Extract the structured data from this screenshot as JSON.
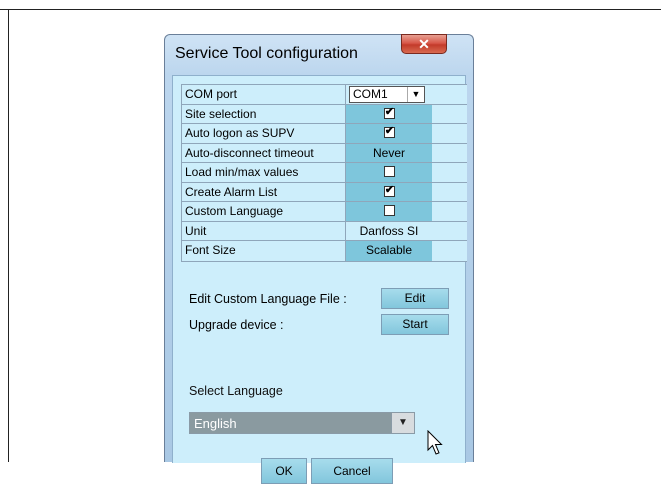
{
  "window": {
    "title": "Service Tool configuration",
    "close_icon": "close-icon"
  },
  "settings": [
    {
      "label": "COM port",
      "type": "combo",
      "value": "COM1"
    },
    {
      "label": "Site selection",
      "type": "checkbox",
      "checked": true
    },
    {
      "label": "Auto logon as SUPV",
      "type": "checkbox",
      "checked": true
    },
    {
      "label": "Auto-disconnect timeout",
      "type": "text",
      "value": "Never"
    },
    {
      "label": "Load min/max values",
      "type": "checkbox",
      "checked": false
    },
    {
      "label": "Create Alarm List",
      "type": "checkbox",
      "checked": true
    },
    {
      "label": "Custom Language",
      "type": "checkbox",
      "checked": false
    },
    {
      "label": "Unit",
      "type": "text-plain",
      "value": "Danfoss SI"
    },
    {
      "label": "Font Size",
      "type": "text",
      "value": "Scalable"
    }
  ],
  "actions": {
    "edit_custom_language_label": "Edit Custom Language File :",
    "edit_button": "Edit",
    "upgrade_device_label": "Upgrade device :",
    "start_button": "Start"
  },
  "language": {
    "label": "Select Language",
    "selected": "English"
  },
  "buttons": {
    "ok": "OK",
    "cancel": "Cancel"
  },
  "colors": {
    "client_bg": "#cdeefb",
    "value_cell_bg": "#7ec6dc",
    "close_button": "#c33a2a"
  }
}
